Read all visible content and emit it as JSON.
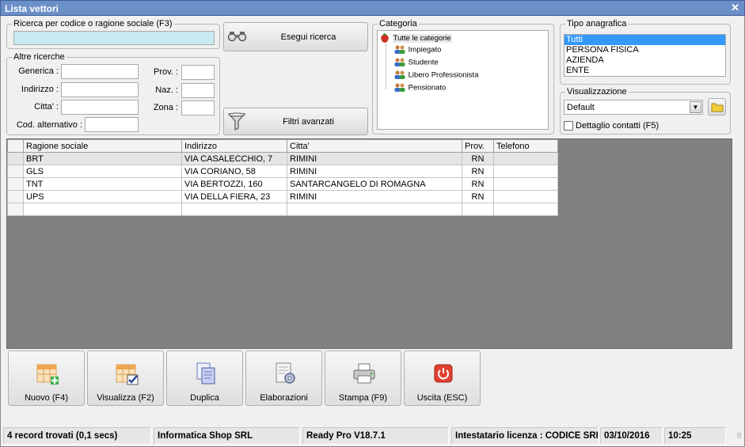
{
  "window": {
    "title": "Lista vettori"
  },
  "search": {
    "legend": "Ricerca per codice o ragione sociale (F3)",
    "value": "",
    "run_button": "Esegui ricerca",
    "filter_button": "Filtri avanzati"
  },
  "other": {
    "legend": "Altre ricerche",
    "generica": "Generica :",
    "indirizzo": "Indirizzo :",
    "citta": "Citta' :",
    "cod_alt": "Cod. alternativo :",
    "prov": "Prov. :",
    "naz": "Naz. :",
    "zona": "Zona :"
  },
  "categoria": {
    "legend": "Categoria",
    "root": "Tutte le categorie",
    "items": [
      "Impiegato",
      "Studente",
      "Libero Professionista",
      "Pensionato"
    ]
  },
  "tipo": {
    "legend": "Tipo anagrafica",
    "options": [
      "Tutti",
      "PERSONA FISICA",
      "AZIENDA",
      "ENTE"
    ],
    "selected": "Tutti"
  },
  "visualizzazione": {
    "legend": "Visualizzazione",
    "value": "Default",
    "dettaglio": "Dettaglio contatti (F5)",
    "dettaglio_checked": false
  },
  "grid": {
    "columns": [
      "Ragione sociale",
      "Indirizzo",
      "Citta'",
      "Prov.",
      "Telefono"
    ],
    "rows": [
      [
        "BRT",
        "VIA CASALECCHIO, 7",
        "RIMINI",
        "RN",
        ""
      ],
      [
        "GLS",
        "VIA CORIANO, 58",
        "RIMINI",
        "RN",
        ""
      ],
      [
        "TNT",
        "VIA BERTOZZI, 160",
        "SANTARCANGELO DI ROMAGNA",
        "RN",
        ""
      ],
      [
        "UPS",
        "VIA DELLA FIERA, 23",
        "RIMINI",
        "RN",
        ""
      ]
    ]
  },
  "actions": {
    "nuovo": "Nuovo (F4)",
    "visualizza": "Visualizza (F2)",
    "duplica": "Duplica",
    "elaborazioni": "Elaborazioni",
    "stampa": "Stampa (F9)",
    "uscita": "Uscita (ESC)"
  },
  "status": {
    "records": "4 record trovati (0,1 secs)",
    "company": "Informatica Shop SRL",
    "version": "Ready Pro V18.7.1",
    "license": "Intestatario licenza : CODICE SRL",
    "date": "03/10/2016",
    "time": "10:25"
  },
  "colors": {
    "titlebar": "#6b8fc7",
    "selection": "#3399ff",
    "search_field": "#c6eaf0",
    "grid_bg": "#808080"
  }
}
